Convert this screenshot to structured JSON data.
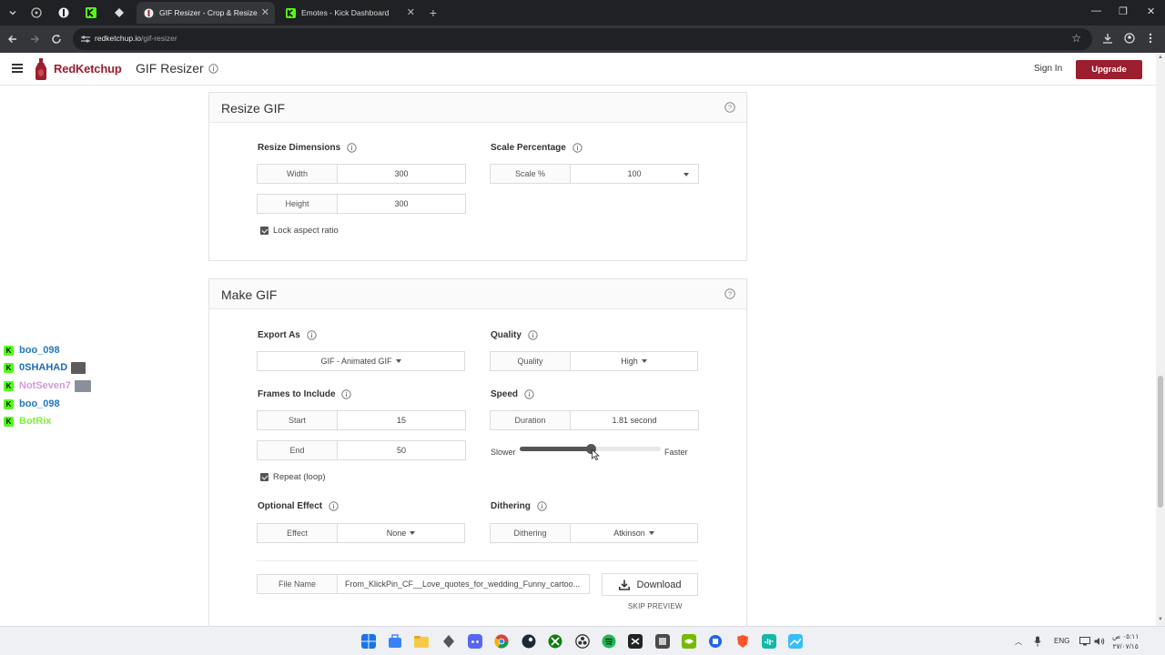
{
  "browser": {
    "tabs": [
      {
        "title": "GIF Resizer - Crop & Resize Animated GIFs",
        "active": true,
        "favicon": "redketchup-icon"
      },
      {
        "title": "Emotes - Kick Dashboard",
        "active": false,
        "favicon": "kick-icon"
      }
    ],
    "url_host": "redketchup.io",
    "url_path": "/gif-resizer"
  },
  "header": {
    "brand": "RedKetchup",
    "title": "GIF Resizer",
    "sign_in": "Sign In",
    "upgrade": "Upgrade"
  },
  "resize_section": {
    "title": "Resize GIF",
    "dimensions": {
      "label": "Resize Dimensions",
      "width_label": "Width",
      "width_value": "300",
      "height_label": "Height",
      "height_value": "300",
      "lock_label": "Lock aspect ratio",
      "lock_checked": true
    },
    "scale": {
      "label": "Scale Percentage",
      "field_label": "Scale %",
      "value": "100"
    }
  },
  "make_section": {
    "title": "Make GIF",
    "export": {
      "label": "Export As",
      "value": "GIF - Animated GIF"
    },
    "quality": {
      "label": "Quality",
      "field_label": "Quality",
      "value": "High"
    },
    "frames": {
      "label": "Frames to Include",
      "start_label": "Start",
      "start_value": "15",
      "end_label": "End",
      "end_value": "50",
      "repeat_label": "Repeat (loop)",
      "repeat_checked": true
    },
    "speed": {
      "label": "Speed",
      "duration_label": "Duration",
      "duration_value": "1.81 second",
      "slower": "Slower",
      "faster": "Faster",
      "level": 0.5
    },
    "effect": {
      "label": "Optional Effect",
      "field_label": "Effect",
      "value": "None"
    },
    "dithering": {
      "label": "Dithering",
      "field_label": "Dithering",
      "value": "Atkinson"
    },
    "file": {
      "label": "File Name",
      "value": "From_KlickPin_CF__Love_quotes_for_wedding_Funny_cartoo..."
    },
    "download": "Download",
    "skip_preview": "SKIP PREVIEW"
  },
  "chat": [
    {
      "name": "boo_098",
      "color": "#1f78c1",
      "avatar": false
    },
    {
      "name": "0SHAHAD",
      "color": "#1f6bb0",
      "avatar": true
    },
    {
      "name": "NotSeven7",
      "color": "#d39ad8",
      "avatar": true
    },
    {
      "name": "boo_098",
      "color": "#1f78c1",
      "avatar": false
    },
    {
      "name": "BotRix",
      "color": "#7cf23b",
      "avatar": false
    }
  ],
  "taskbar": {
    "lang": "ENG",
    "time": "٠٥:١١ ص",
    "date": "٢٧/٠٧/١٥"
  },
  "colors": {
    "brand_red": "#9b1f2e",
    "kick_green": "#53fc18"
  }
}
